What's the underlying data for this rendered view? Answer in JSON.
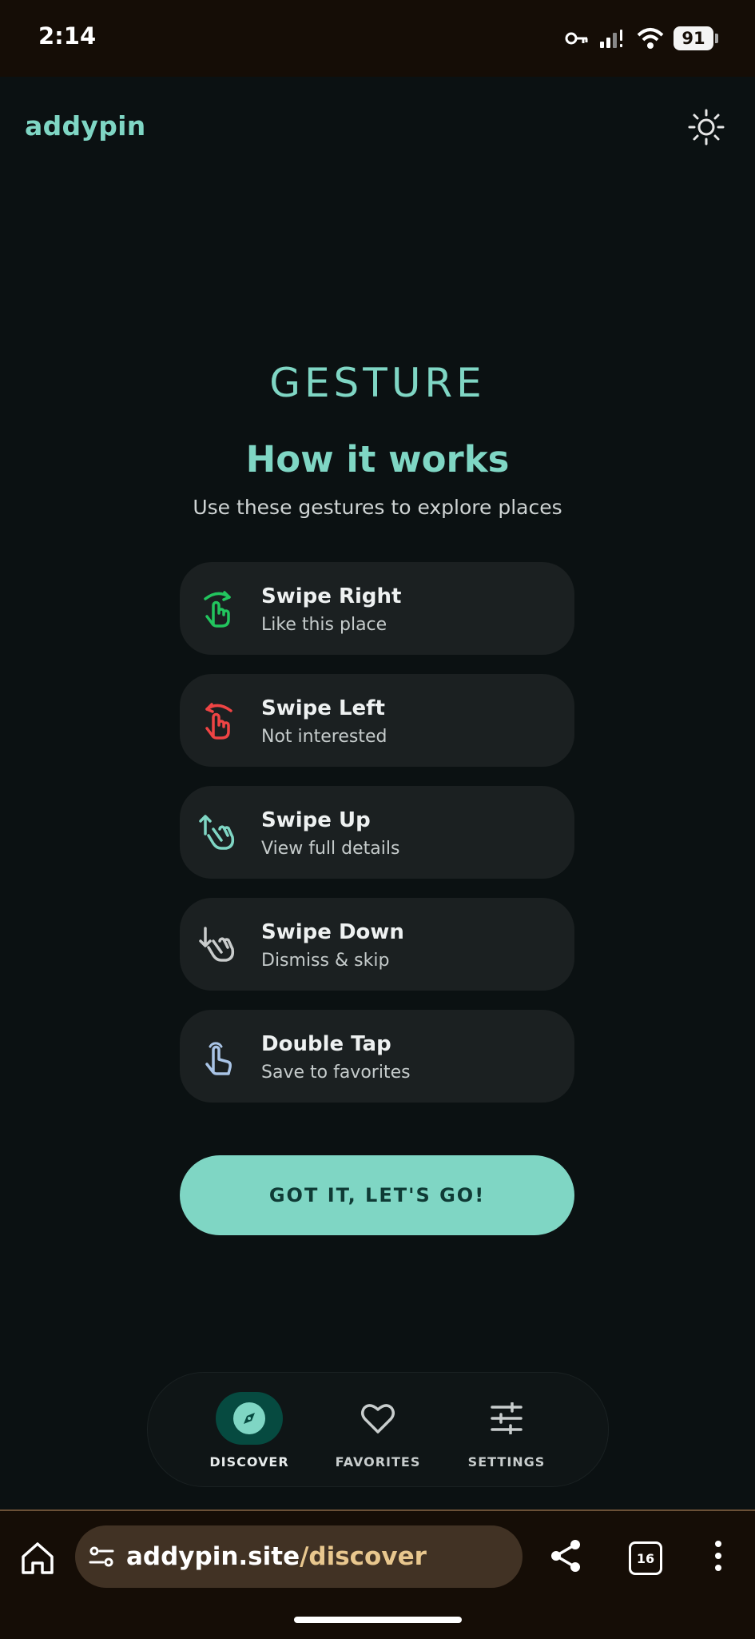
{
  "status_bar": {
    "time": "2:14",
    "battery": "91",
    "icons": [
      "key-icon",
      "signal-icon",
      "wifi-icon",
      "battery-icon"
    ]
  },
  "header": {
    "logo": "addypin",
    "theme_icon": "sun-icon"
  },
  "hero": {
    "brand": "GESTURE",
    "title": "How it works",
    "subtitle": "Use these gestures to explore places"
  },
  "gestures": [
    {
      "title": "Swipe Right",
      "desc": "Like this place",
      "icon": "swipe-right-icon",
      "color": "#22c55e"
    },
    {
      "title": "Swipe Left",
      "desc": "Not interested",
      "icon": "swipe-left-icon",
      "color": "#ef4444"
    },
    {
      "title": "Swipe Up",
      "desc": "View full details",
      "icon": "swipe-up-icon",
      "color": "#7fd6c4"
    },
    {
      "title": "Swipe Down",
      "desc": "Dismiss & skip",
      "icon": "swipe-down-icon",
      "color": "#c9cccc"
    },
    {
      "title": "Double Tap",
      "desc": "Save to favorites",
      "icon": "double-tap-icon",
      "color": "#a9c4e6"
    }
  ],
  "cta": {
    "label": "GOT IT, LET'S GO!"
  },
  "nav": {
    "items": [
      {
        "label": "DISCOVER",
        "icon": "compass-icon",
        "active": true
      },
      {
        "label": "FAVORITES",
        "icon": "heart-icon",
        "active": false
      },
      {
        "label": "SETTINGS",
        "icon": "sliders-icon",
        "active": false
      }
    ]
  },
  "browser": {
    "url_host": "addypin.site",
    "url_path": "/discover",
    "tab_count": "16"
  },
  "colors": {
    "accent": "#7fd6c4",
    "background": "#0b1112",
    "card": "#1b2021",
    "nav_active": "#064a40"
  }
}
